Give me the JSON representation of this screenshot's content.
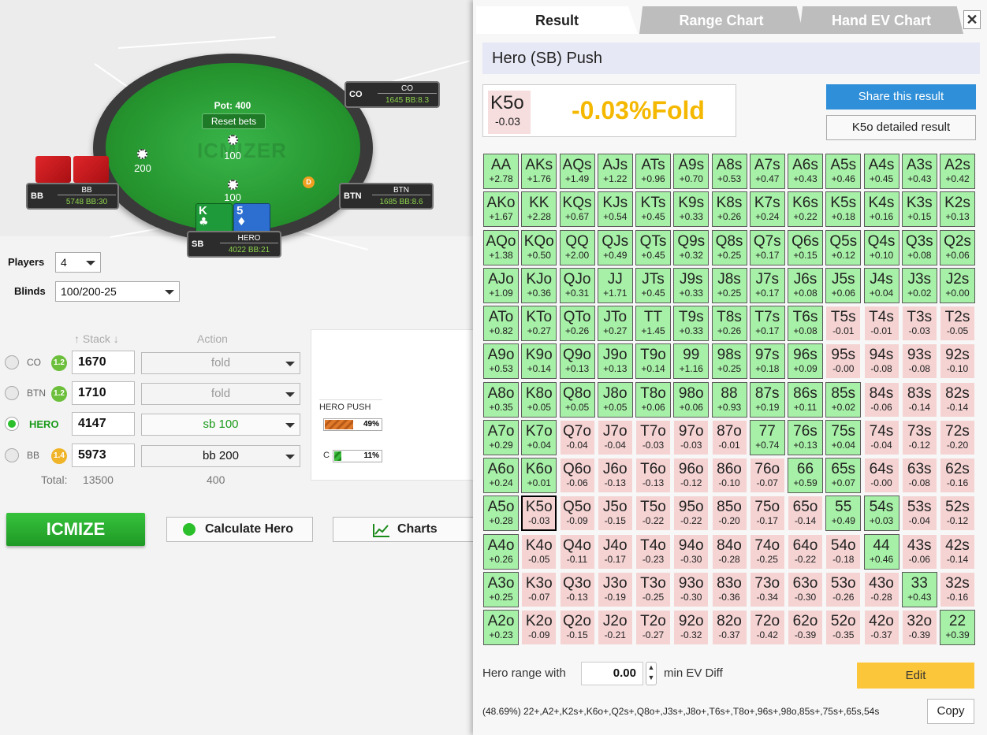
{
  "table": {
    "watermark": "ICMIZER",
    "pot_label": "Pot: 400",
    "reset_bets_label": "Reset bets",
    "bets": {
      "bb": "200",
      "sb_top": "100",
      "sb": "100"
    },
    "dealer_label": "D",
    "seats": [
      {
        "id": "co",
        "pos": "CO",
        "name": "CO",
        "stack": "1645",
        "bb": "BB:8.3"
      },
      {
        "id": "btn",
        "pos": "BTN",
        "name": "BTN",
        "stack": "1685",
        "bb": "BB:8.6"
      },
      {
        "id": "bb",
        "pos": "BB",
        "name": "BB",
        "stack": "5748",
        "bb": "BB:30"
      },
      {
        "id": "sb",
        "pos": "SB",
        "name": "HERO",
        "stack": "4022",
        "bb": "BB:21"
      }
    ],
    "hero_cards": [
      {
        "rank": "K",
        "suit": "♣"
      },
      {
        "rank": "5",
        "suit": "♦"
      }
    ]
  },
  "settings": {
    "players_label": "Players",
    "players_value": "4",
    "blinds_label": "Blinds",
    "blinds_value": "100/200-25"
  },
  "columns": {
    "stack": "Stack",
    "action": "Action"
  },
  "players": [
    {
      "pos": "CO",
      "icm": "1.2",
      "stack": "1670",
      "action": "fold"
    },
    {
      "pos": "BTN",
      "icm": "1.2",
      "stack": "1710",
      "action": "fold"
    },
    {
      "pos": "HERO",
      "icm": "",
      "stack": "4147",
      "action": "sb 100"
    },
    {
      "pos": "BB",
      "icm": "1.4",
      "stack": "5973",
      "action": "bb 200"
    }
  ],
  "totals": {
    "label": "Total:",
    "stack": "13500",
    "action": "400"
  },
  "mini": {
    "title": "HERO PUSH",
    "push_pct": "49%",
    "c_label": "C",
    "call_pct": "11%"
  },
  "buttons": {
    "icmize": "ICMIZE",
    "calc_hero": "Calculate Hero",
    "charts": "Charts"
  },
  "tabs": [
    "Result",
    "Range Chart",
    "Hand EV Chart"
  ],
  "close_label": "✕",
  "result": {
    "title": "Hero (SB) Push",
    "hand": "K5o",
    "ev": "-0.03",
    "big_text": "-0.03%Fold",
    "share_label": "Share this result",
    "detail_label": "K5o detailed result"
  },
  "grid": {
    "hands": [
      [
        "AA",
        "AKs",
        "AQs",
        "AJs",
        "ATs",
        "A9s",
        "A8s",
        "A7s",
        "A6s",
        "A5s",
        "A4s",
        "A3s",
        "A2s"
      ],
      [
        "AKo",
        "KK",
        "KQs",
        "KJs",
        "KTs",
        "K9s",
        "K8s",
        "K7s",
        "K6s",
        "K5s",
        "K4s",
        "K3s",
        "K2s"
      ],
      [
        "AQo",
        "KQo",
        "QQ",
        "QJs",
        "QTs",
        "Q9s",
        "Q8s",
        "Q7s",
        "Q6s",
        "Q5s",
        "Q4s",
        "Q3s",
        "Q2s"
      ],
      [
        "AJo",
        "KJo",
        "QJo",
        "JJ",
        "JTs",
        "J9s",
        "J8s",
        "J7s",
        "J6s",
        "J5s",
        "J4s",
        "J3s",
        "J2s"
      ],
      [
        "ATo",
        "KTo",
        "QTo",
        "JTo",
        "TT",
        "T9s",
        "T8s",
        "T7s",
        "T6s",
        "T5s",
        "T4s",
        "T3s",
        "T2s"
      ],
      [
        "A9o",
        "K9o",
        "Q9o",
        "J9o",
        "T9o",
        "99",
        "98s",
        "97s",
        "96s",
        "95s",
        "94s",
        "93s",
        "92s"
      ],
      [
        "A8o",
        "K8o",
        "Q8o",
        "J8o",
        "T8o",
        "98o",
        "88",
        "87s",
        "86s",
        "85s",
        "84s",
        "83s",
        "82s"
      ],
      [
        "A7o",
        "K7o",
        "Q7o",
        "J7o",
        "T7o",
        "97o",
        "87o",
        "77",
        "76s",
        "75s",
        "74s",
        "73s",
        "72s"
      ],
      [
        "A6o",
        "K6o",
        "Q6o",
        "J6o",
        "T6o",
        "96o",
        "86o",
        "76o",
        "66",
        "65s",
        "64s",
        "63s",
        "62s"
      ],
      [
        "A5o",
        "K5o",
        "Q5o",
        "J5o",
        "T5o",
        "95o",
        "85o",
        "75o",
        "65o",
        "55",
        "54s",
        "53s",
        "52s"
      ],
      [
        "A4o",
        "K4o",
        "Q4o",
        "J4o",
        "T4o",
        "94o",
        "84o",
        "74o",
        "64o",
        "54o",
        "44",
        "43s",
        "42s"
      ],
      [
        "A3o",
        "K3o",
        "Q3o",
        "J3o",
        "T3o",
        "93o",
        "83o",
        "73o",
        "63o",
        "53o",
        "43o",
        "33",
        "32s"
      ],
      [
        "A2o",
        "K2o",
        "Q2o",
        "J2o",
        "T2o",
        "92o",
        "82o",
        "72o",
        "62o",
        "52o",
        "42o",
        "32o",
        "22"
      ]
    ],
    "values": [
      [
        "+2.78",
        "+1.76",
        "+1.49",
        "+1.22",
        "+0.96",
        "+0.70",
        "+0.53",
        "+0.47",
        "+0.43",
        "+0.46",
        "+0.45",
        "+0.43",
        "+0.42"
      ],
      [
        "+1.67",
        "+2.28",
        "+0.67",
        "+0.54",
        "+0.45",
        "+0.33",
        "+0.26",
        "+0.24",
        "+0.22",
        "+0.18",
        "+0.16",
        "+0.15",
        "+0.13"
      ],
      [
        "+1.38",
        "+0.50",
        "+2.00",
        "+0.49",
        "+0.45",
        "+0.32",
        "+0.25",
        "+0.17",
        "+0.15",
        "+0.12",
        "+0.10",
        "+0.08",
        "+0.06"
      ],
      [
        "+1.09",
        "+0.36",
        "+0.31",
        "+1.71",
        "+0.45",
        "+0.33",
        "+0.25",
        "+0.17",
        "+0.08",
        "+0.06",
        "+0.04",
        "+0.02",
        "+0.00"
      ],
      [
        "+0.82",
        "+0.27",
        "+0.26",
        "+0.27",
        "+1.45",
        "+0.33",
        "+0.26",
        "+0.17",
        "+0.08",
        "-0.01",
        "-0.01",
        "-0.03",
        "-0.05"
      ],
      [
        "+0.53",
        "+0.14",
        "+0.13",
        "+0.13",
        "+0.14",
        "+1.16",
        "+0.25",
        "+0.18",
        "+0.09",
        "-0.00",
        "-0.08",
        "-0.08",
        "-0.10"
      ],
      [
        "+0.35",
        "+0.05",
        "+0.05",
        "+0.05",
        "+0.06",
        "+0.06",
        "+0.93",
        "+0.19",
        "+0.11",
        "+0.02",
        "-0.06",
        "-0.14",
        "-0.14"
      ],
      [
        "+0.29",
        "+0.04",
        "-0.04",
        "-0.04",
        "-0.03",
        "-0.03",
        "-0.01",
        "+0.74",
        "+0.13",
        "+0.04",
        "-0.04",
        "-0.12",
        "-0.20"
      ],
      [
        "+0.24",
        "+0.01",
        "-0.06",
        "-0.13",
        "-0.13",
        "-0.12",
        "-0.10",
        "-0.07",
        "+0.59",
        "+0.07",
        "-0.00",
        "-0.08",
        "-0.16"
      ],
      [
        "+0.28",
        "-0.03",
        "-0.09",
        "-0.15",
        "-0.22",
        "-0.22",
        "-0.20",
        "-0.17",
        "-0.14",
        "+0.49",
        "+0.03",
        "-0.04",
        "-0.12"
      ],
      [
        "+0.26",
        "-0.05",
        "-0.11",
        "-0.17",
        "-0.23",
        "-0.30",
        "-0.28",
        "-0.25",
        "-0.22",
        "-0.18",
        "+0.46",
        "-0.06",
        "-0.14"
      ],
      [
        "+0.25",
        "-0.07",
        "-0.13",
        "-0.19",
        "-0.25",
        "-0.30",
        "-0.36",
        "-0.34",
        "-0.30",
        "-0.26",
        "-0.28",
        "+0.43",
        "-0.16"
      ],
      [
        "+0.23",
        "-0.09",
        "-0.15",
        "-0.21",
        "-0.27",
        "-0.32",
        "-0.37",
        "-0.42",
        "-0.39",
        "-0.35",
        "-0.37",
        "-0.39",
        "+0.39"
      ]
    ],
    "pushed_hands": [
      "AA",
      "AKs",
      "AQs",
      "AJs",
      "ATs",
      "A9s",
      "A8s",
      "A7s",
      "A6s",
      "A5s",
      "A4s",
      "A3s",
      "A2s",
      "AKo",
      "KK",
      "KQs",
      "KJs",
      "KTs",
      "K9s",
      "K8s",
      "K7s",
      "K6s",
      "K5s",
      "K4s",
      "K3s",
      "K2s",
      "AQo",
      "KQo",
      "QQ",
      "QJs",
      "QTs",
      "Q9s",
      "Q8s",
      "Q7s",
      "Q6s",
      "Q5s",
      "Q4s",
      "Q3s",
      "Q2s",
      "AJo",
      "KJo",
      "QJo",
      "JJ",
      "JTs",
      "J9s",
      "J8s",
      "J7s",
      "J6s",
      "J5s",
      "J4s",
      "J3s",
      "J2s",
      "ATo",
      "KTo",
      "QTo",
      "JTo",
      "TT",
      "T9s",
      "T8s",
      "T7s",
      "T6s",
      "A9o",
      "K9o",
      "Q9o",
      "J9o",
      "T9o",
      "99",
      "98s",
      "97s",
      "96s",
      "A8o",
      "K8o",
      "Q8o",
      "J8o",
      "T8o",
      "98o",
      "88",
      "87s",
      "86s",
      "85s",
      "A7o",
      "K7o",
      "77",
      "76s",
      "75s",
      "A6o",
      "K6o",
      "66",
      "65s",
      "A5o",
      "55",
      "54s",
      "A4o",
      "44",
      "A3o",
      "33",
      "A2o",
      "22"
    ],
    "selected": "K5o"
  },
  "bottom": {
    "range_label": "Hero range with",
    "min_ev": "0.00",
    "spin_up": "▲",
    "spin_down": "▼",
    "min_ev_label": "min EV Diff",
    "edit_label": "Edit",
    "range_string": "(48.69%) 22+,A2+,K2s+,K6o+,Q2s+,Q8o+,J3s+,J8o+,T6s+,T8o+,96s+,98o,85s+,75s+,65s,54s",
    "copy_label": "Copy"
  },
  "colors": {
    "push": "#a7f0a7",
    "fold": "#f5d3d3",
    "accent": "#2f8fd8",
    "edit": "#fcc63a",
    "icmize": "#2bb130",
    "big_text": "#f5b800"
  }
}
